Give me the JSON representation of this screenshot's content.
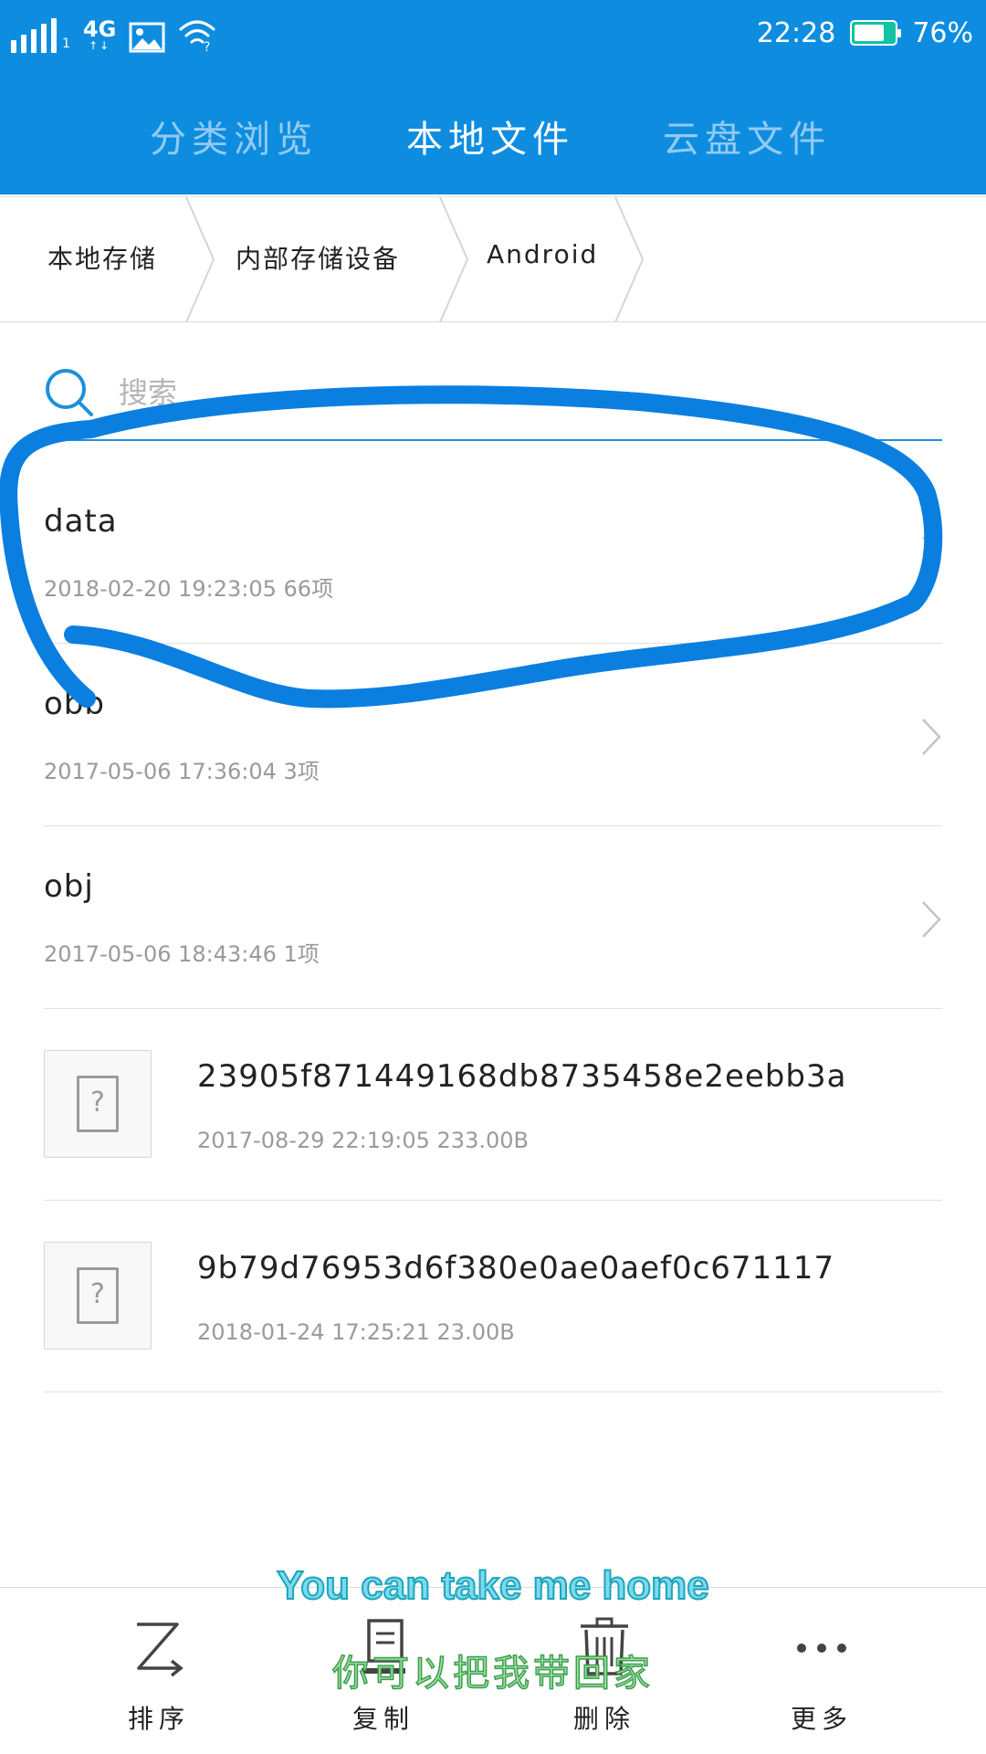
{
  "status_bar": {
    "sim_slot": "1",
    "network": "4G",
    "time": "22:28",
    "battery_percent": "76%",
    "battery_level": 0.76,
    "icons": [
      "signal-icon",
      "4g-icon",
      "image-notification-icon",
      "wifi-icon",
      "battery-icon"
    ]
  },
  "tabs": [
    {
      "label": "分类浏览",
      "active": false
    },
    {
      "label": "本地文件",
      "active": true
    },
    {
      "label": "云盘文件",
      "active": false
    }
  ],
  "breadcrumb": [
    "本地存储",
    "内部存储设备",
    "Android"
  ],
  "search": {
    "placeholder": "搜索",
    "value": ""
  },
  "folders": [
    {
      "name": "data",
      "meta": "2018-02-20 19:23:05 66项"
    },
    {
      "name": "obb",
      "meta": "2017-05-06 17:36:04 3项"
    },
    {
      "name": "obj",
      "meta": "2017-05-06 18:43:46 1项"
    }
  ],
  "files": [
    {
      "name": "23905f871449168db8735458e2eebb3a",
      "meta": "2017-08-29 22:19:05 233.00B",
      "icon": "?"
    },
    {
      "name": "9b79d76953d6f380e0ae0aef0c671117",
      "meta": "2018-01-24 17:25:21 23.00B",
      "icon": "?"
    }
  ],
  "toolbar": [
    {
      "label": "排序",
      "icon": "sort-icon"
    },
    {
      "label": "复制",
      "icon": "copy-icon"
    },
    {
      "label": "删除",
      "icon": "delete-icon"
    },
    {
      "label": "更多",
      "icon": "more-icon"
    }
  ],
  "overlay_caption": {
    "english": "You can take me home",
    "chinese": "你可以把我带回家"
  },
  "colors": {
    "header_blue": "#0e8de0",
    "search_underline": "#1e8fdc",
    "annotation_stroke": "#0a7fe0",
    "meta_gray": "#9a9a9a"
  }
}
